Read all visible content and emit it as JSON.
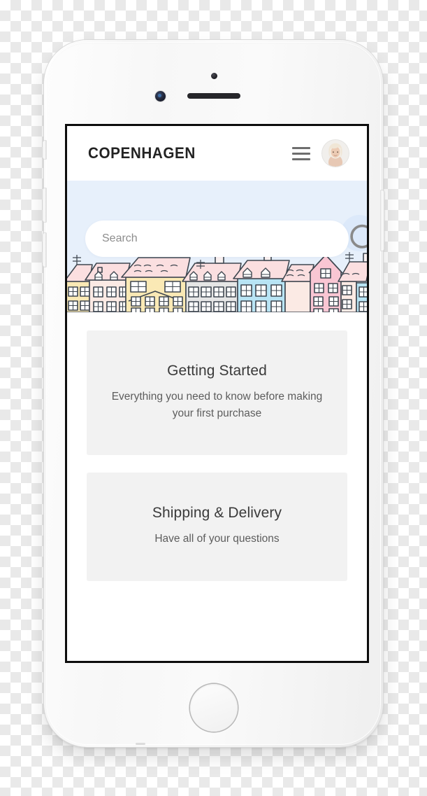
{
  "device": {
    "type": "smartphone-mockup",
    "color": "white-silver",
    "hardware": {
      "sensor": "proximity-sensor",
      "camera": "front-camera",
      "speaker": "earpiece-speaker",
      "home_button": "home-button",
      "silent_switch": "silent-switch",
      "volume_up": "volume-up-button",
      "volume_down": "volume-down-button",
      "power": "power-button"
    }
  },
  "app": {
    "header": {
      "brand": "COPENHAGEN",
      "menu_icon": "hamburger-menu-icon",
      "avatar_alt": "user-avatar"
    },
    "hero": {
      "illustration": "copenhagen-nyhavn-houses-line-illustration",
      "sky_color": "#e7f0fb",
      "house_colors": [
        "#fbdfe0",
        "#fae6a8",
        "#f9f0c9",
        "#e4e4e4",
        "#b8e4f4",
        "#f9c6d3",
        "#fbdfe0"
      ],
      "outline_color": "#3f4750"
    },
    "search": {
      "placeholder": "Search",
      "value": "",
      "icon": "magnifier-icon"
    },
    "cards": [
      {
        "title": "Getting Started",
        "description": "Everything you need to know before making your first purchase"
      },
      {
        "title": "Shipping & Delivery",
        "description": "Have all of your questions"
      }
    ]
  },
  "colors": {
    "card_background": "#f2f2f2",
    "title_text": "#232323",
    "body_text": "#5d5d5d",
    "sky": "#e7f0fb"
  }
}
